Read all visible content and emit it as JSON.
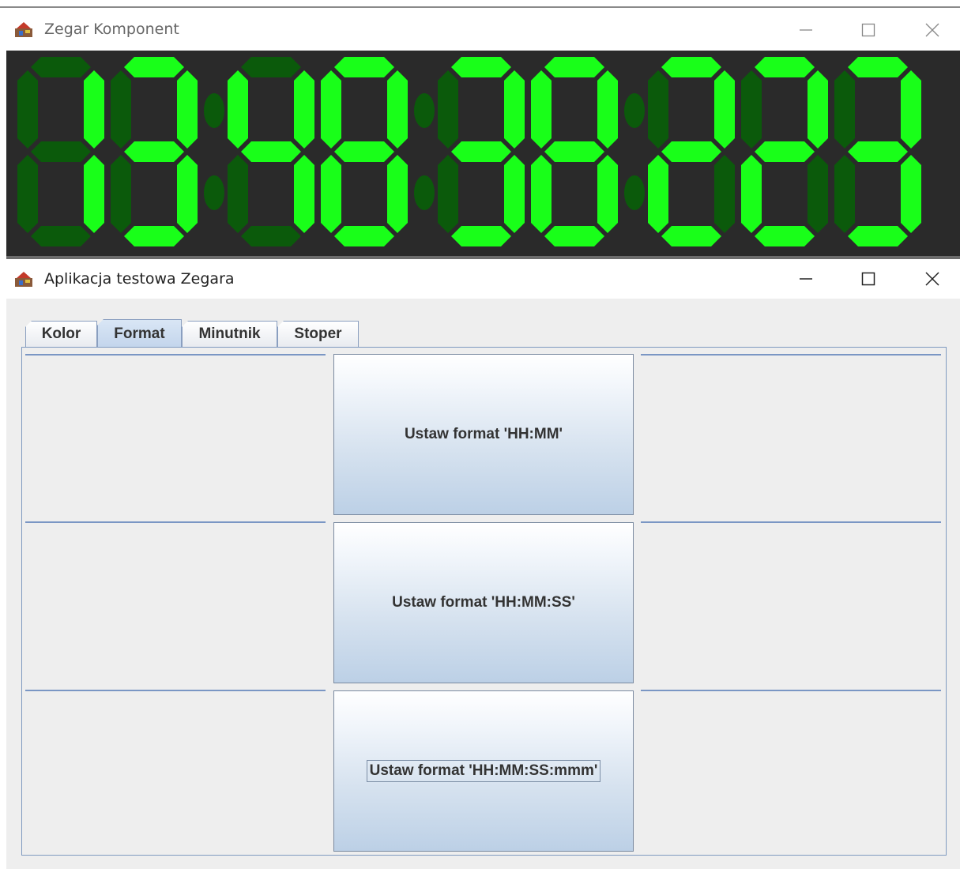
{
  "clock_window": {
    "title": "Zegar Komponent",
    "display": {
      "time": "13:48:38:223",
      "lit_color": "#19ff19",
      "dim_color": "#0b5a0b",
      "background": "#2a2a2a"
    }
  },
  "app_window": {
    "title": "Aplikacja testowa Zegara",
    "tabs": [
      {
        "label": "Kolor",
        "active": false
      },
      {
        "label": "Format",
        "active": true
      },
      {
        "label": "Minutnik",
        "active": false
      },
      {
        "label": "Stoper",
        "active": false
      }
    ],
    "buttons": [
      {
        "label": "Ustaw format 'HH:MM'",
        "focused": false
      },
      {
        "label": "Ustaw format 'HH:MM:SS'",
        "focused": false
      },
      {
        "label": "Ustaw format 'HH:MM:SS:mmm'",
        "focused": true
      }
    ]
  },
  "icons": [
    "java-app-icon",
    "minimize-icon",
    "maximize-icon",
    "close-icon"
  ]
}
